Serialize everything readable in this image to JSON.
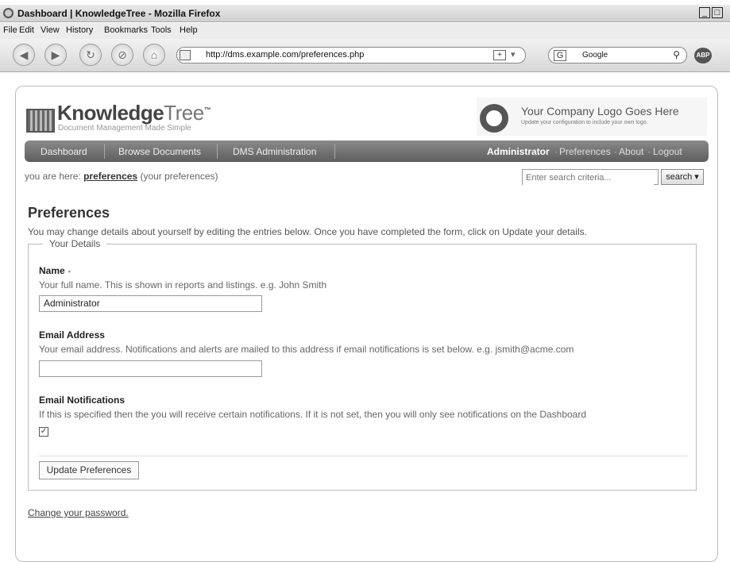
{
  "browser": {
    "window_title": "Dashboard | KnowledgeTree - Mozilla Firefox",
    "menu": [
      "File",
      "Edit",
      "View",
      "History",
      "Bookmarks",
      "Tools",
      "Help"
    ],
    "url": "http://dms.example.com/preferences.php",
    "search_engine": "Google",
    "addon_badge": "ABP"
  },
  "header": {
    "logo_bold": "Knowledge",
    "logo_light": "Tree",
    "logo_tm": "™",
    "tagline": "Document Management Made Simple",
    "company_title": "Your Company Logo Goes Here",
    "company_sub": "Update your configuration to include your own logo."
  },
  "nav": {
    "left": [
      "Dashboard",
      "Browse Documents",
      "DMS Administration"
    ],
    "user": "Administrator",
    "right": [
      "Preferences",
      "About",
      "Logout"
    ]
  },
  "breadcrumb": {
    "prefix": "you are here:",
    "current": "preferences",
    "suffix": "(your preferences)"
  },
  "search": {
    "placeholder": "Enter search criteria...",
    "button": "search ▾"
  },
  "main": {
    "title": "Preferences",
    "intro": "You may change details about yourself by editing the entries below. Once you have completed the form, click on Update your details.",
    "legend": "Your Details",
    "fields": [
      {
        "label": "Name",
        "required_mark": "▪",
        "desc": "Your full name. This is shown in reports and listings. e.g. John Smith",
        "value": "Administrator"
      },
      {
        "label": "Email Address",
        "desc": "Your email address. Notifications and alerts are mailed to this address if email notifications is set below. e.g. jsmith@acme.com",
        "value": ""
      },
      {
        "label": "Email Notifications",
        "desc": "If this is specified then the you will receive certain notifications. If it is not set, then you will only see notifications on the Dashboard",
        "checked_mark": "✓"
      }
    ],
    "submit": "Update Preferences",
    "change_password": "Change your password."
  }
}
